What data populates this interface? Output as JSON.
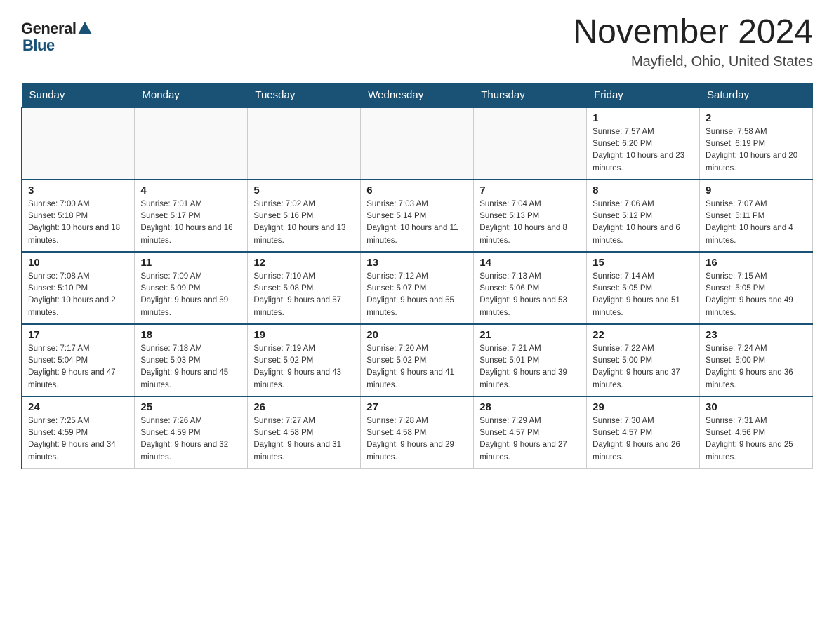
{
  "header": {
    "logo_general": "General",
    "logo_blue": "Blue",
    "month_title": "November 2024",
    "location": "Mayfield, Ohio, United States"
  },
  "days_of_week": [
    "Sunday",
    "Monday",
    "Tuesday",
    "Wednesday",
    "Thursday",
    "Friday",
    "Saturday"
  ],
  "weeks": [
    {
      "days": [
        {
          "num": "",
          "info": "",
          "empty": true
        },
        {
          "num": "",
          "info": "",
          "empty": true
        },
        {
          "num": "",
          "info": "",
          "empty": true
        },
        {
          "num": "",
          "info": "",
          "empty": true
        },
        {
          "num": "",
          "info": "",
          "empty": true
        },
        {
          "num": "1",
          "info": "Sunrise: 7:57 AM\nSunset: 6:20 PM\nDaylight: 10 hours and 23 minutes."
        },
        {
          "num": "2",
          "info": "Sunrise: 7:58 AM\nSunset: 6:19 PM\nDaylight: 10 hours and 20 minutes."
        }
      ]
    },
    {
      "days": [
        {
          "num": "3",
          "info": "Sunrise: 7:00 AM\nSunset: 5:18 PM\nDaylight: 10 hours and 18 minutes."
        },
        {
          "num": "4",
          "info": "Sunrise: 7:01 AM\nSunset: 5:17 PM\nDaylight: 10 hours and 16 minutes."
        },
        {
          "num": "5",
          "info": "Sunrise: 7:02 AM\nSunset: 5:16 PM\nDaylight: 10 hours and 13 minutes."
        },
        {
          "num": "6",
          "info": "Sunrise: 7:03 AM\nSunset: 5:14 PM\nDaylight: 10 hours and 11 minutes."
        },
        {
          "num": "7",
          "info": "Sunrise: 7:04 AM\nSunset: 5:13 PM\nDaylight: 10 hours and 8 minutes."
        },
        {
          "num": "8",
          "info": "Sunrise: 7:06 AM\nSunset: 5:12 PM\nDaylight: 10 hours and 6 minutes."
        },
        {
          "num": "9",
          "info": "Sunrise: 7:07 AM\nSunset: 5:11 PM\nDaylight: 10 hours and 4 minutes."
        }
      ]
    },
    {
      "days": [
        {
          "num": "10",
          "info": "Sunrise: 7:08 AM\nSunset: 5:10 PM\nDaylight: 10 hours and 2 minutes."
        },
        {
          "num": "11",
          "info": "Sunrise: 7:09 AM\nSunset: 5:09 PM\nDaylight: 9 hours and 59 minutes."
        },
        {
          "num": "12",
          "info": "Sunrise: 7:10 AM\nSunset: 5:08 PM\nDaylight: 9 hours and 57 minutes."
        },
        {
          "num": "13",
          "info": "Sunrise: 7:12 AM\nSunset: 5:07 PM\nDaylight: 9 hours and 55 minutes."
        },
        {
          "num": "14",
          "info": "Sunrise: 7:13 AM\nSunset: 5:06 PM\nDaylight: 9 hours and 53 minutes."
        },
        {
          "num": "15",
          "info": "Sunrise: 7:14 AM\nSunset: 5:05 PM\nDaylight: 9 hours and 51 minutes."
        },
        {
          "num": "16",
          "info": "Sunrise: 7:15 AM\nSunset: 5:05 PM\nDaylight: 9 hours and 49 minutes."
        }
      ]
    },
    {
      "days": [
        {
          "num": "17",
          "info": "Sunrise: 7:17 AM\nSunset: 5:04 PM\nDaylight: 9 hours and 47 minutes."
        },
        {
          "num": "18",
          "info": "Sunrise: 7:18 AM\nSunset: 5:03 PM\nDaylight: 9 hours and 45 minutes."
        },
        {
          "num": "19",
          "info": "Sunrise: 7:19 AM\nSunset: 5:02 PM\nDaylight: 9 hours and 43 minutes."
        },
        {
          "num": "20",
          "info": "Sunrise: 7:20 AM\nSunset: 5:02 PM\nDaylight: 9 hours and 41 minutes."
        },
        {
          "num": "21",
          "info": "Sunrise: 7:21 AM\nSunset: 5:01 PM\nDaylight: 9 hours and 39 minutes."
        },
        {
          "num": "22",
          "info": "Sunrise: 7:22 AM\nSunset: 5:00 PM\nDaylight: 9 hours and 37 minutes."
        },
        {
          "num": "23",
          "info": "Sunrise: 7:24 AM\nSunset: 5:00 PM\nDaylight: 9 hours and 36 minutes."
        }
      ]
    },
    {
      "days": [
        {
          "num": "24",
          "info": "Sunrise: 7:25 AM\nSunset: 4:59 PM\nDaylight: 9 hours and 34 minutes."
        },
        {
          "num": "25",
          "info": "Sunrise: 7:26 AM\nSunset: 4:59 PM\nDaylight: 9 hours and 32 minutes."
        },
        {
          "num": "26",
          "info": "Sunrise: 7:27 AM\nSunset: 4:58 PM\nDaylight: 9 hours and 31 minutes."
        },
        {
          "num": "27",
          "info": "Sunrise: 7:28 AM\nSunset: 4:58 PM\nDaylight: 9 hours and 29 minutes."
        },
        {
          "num": "28",
          "info": "Sunrise: 7:29 AM\nSunset: 4:57 PM\nDaylight: 9 hours and 27 minutes."
        },
        {
          "num": "29",
          "info": "Sunrise: 7:30 AM\nSunset: 4:57 PM\nDaylight: 9 hours and 26 minutes."
        },
        {
          "num": "30",
          "info": "Sunrise: 7:31 AM\nSunset: 4:56 PM\nDaylight: 9 hours and 25 minutes."
        }
      ]
    }
  ]
}
